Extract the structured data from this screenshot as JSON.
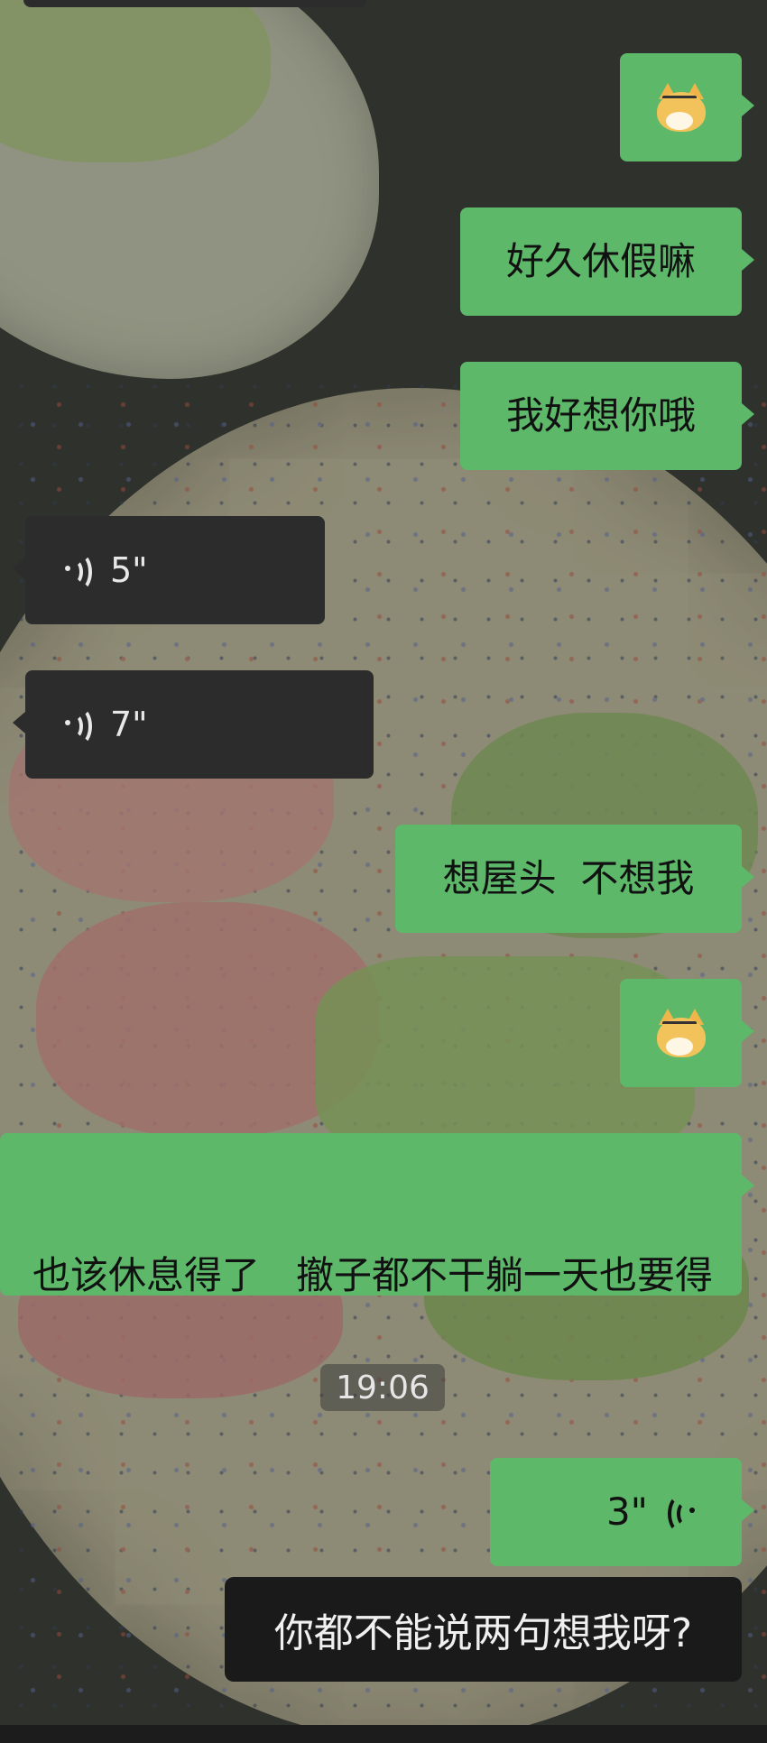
{
  "chat": {
    "messages": [
      {
        "id": "m1",
        "side": "out",
        "type": "sticker",
        "icon": "cat-face-emoji-icon"
      },
      {
        "id": "m2",
        "side": "out",
        "type": "text",
        "text": "好久休假嘛"
      },
      {
        "id": "m3",
        "side": "out",
        "type": "text",
        "text": "我好想你哦"
      },
      {
        "id": "m4",
        "side": "in",
        "type": "voice",
        "duration": "5\""
      },
      {
        "id": "m5",
        "side": "in",
        "type": "voice",
        "duration": "7\""
      },
      {
        "id": "m6",
        "side": "out",
        "type": "text",
        "text": "想屋头  不想我"
      },
      {
        "id": "m7",
        "side": "out",
        "type": "sticker",
        "icon": "cat-face-emoji-icon"
      },
      {
        "id": "m8",
        "side": "out",
        "type": "text",
        "text": "也该休息得了   撤子都不干躺一天也要得"
      },
      {
        "id": "m9",
        "side": "out",
        "type": "voice",
        "duration": "3\""
      }
    ],
    "timestamp": "19:06",
    "caption": "你都不能说两句想我呀?"
  },
  "colors": {
    "outgoing_bubble": "#5db86a",
    "incoming_bubble": "#2c2c2c",
    "caption_background": "#1a1a1a"
  }
}
